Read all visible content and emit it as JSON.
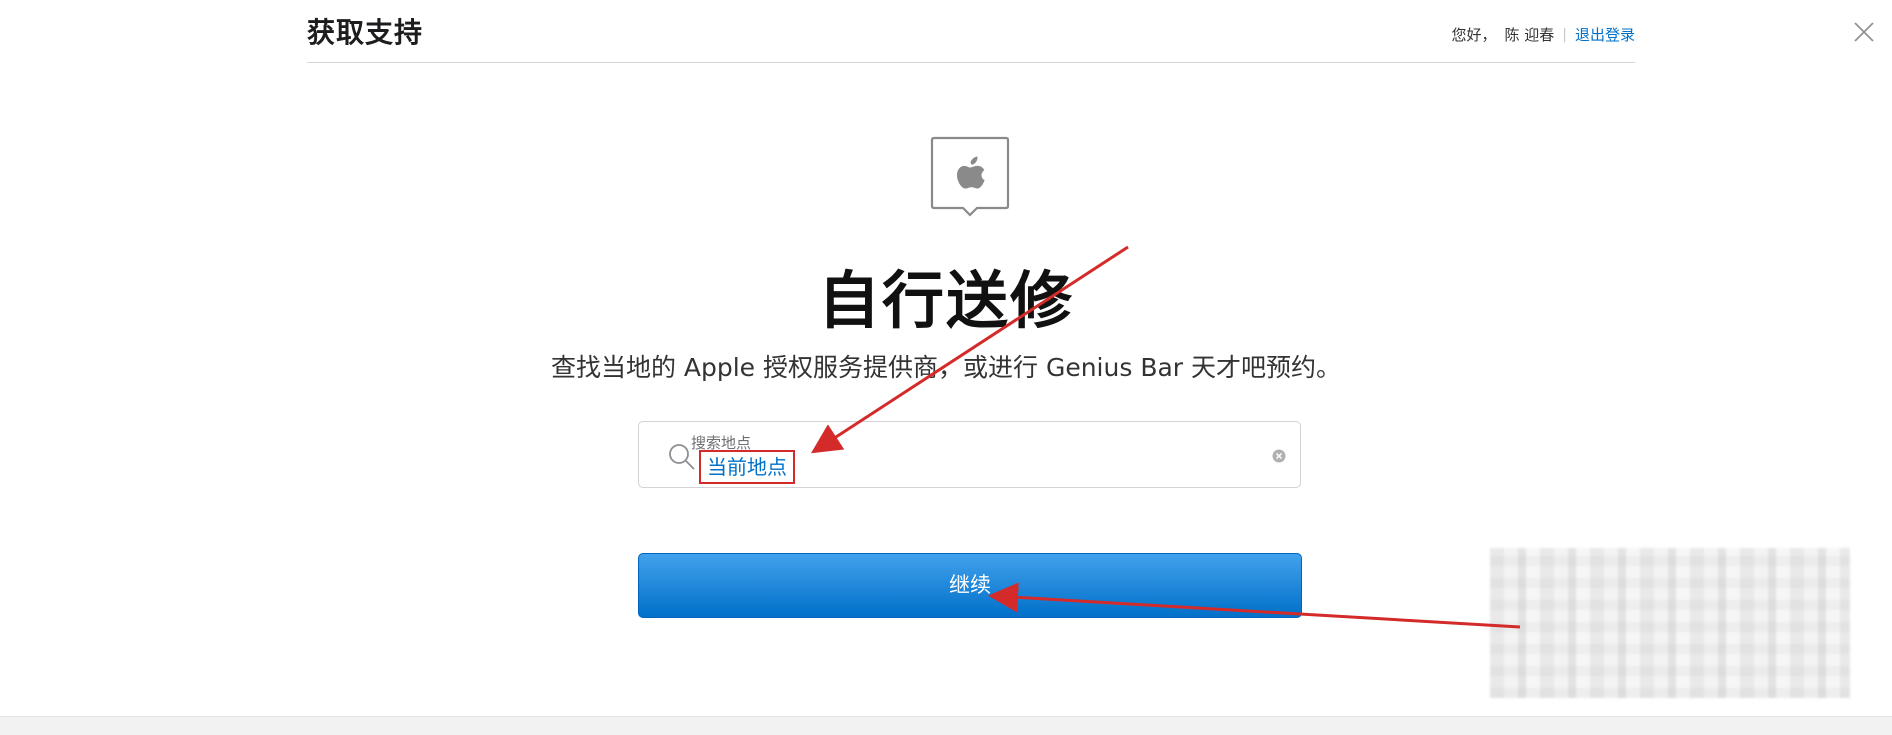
{
  "header": {
    "title": "获取支持",
    "greeting": "您好，",
    "user_name": "陈 迎春",
    "separator": "|",
    "signout_label": "退出登录"
  },
  "main": {
    "title": "自行送修",
    "subtitle": "查找当地的 Apple 授权服务提供商，或进行 Genius Bar 天才吧预约。"
  },
  "search": {
    "label": "搜索地点",
    "value": "当前地点"
  },
  "continue_label": "继续",
  "icons": {
    "logo": "apple-logo-icon",
    "search": "search-icon",
    "clear": "clear-icon",
    "close": "close-icon"
  },
  "colors": {
    "accent": "#0070c9",
    "annotation": "#d42a2a",
    "button_top": "#42a1ec",
    "button_bottom": "#0070c9"
  }
}
